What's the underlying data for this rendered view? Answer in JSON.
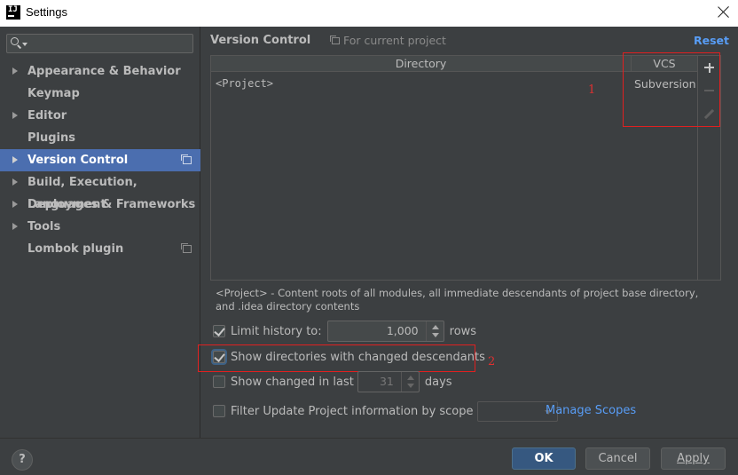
{
  "window": {
    "title": "Settings"
  },
  "sidebar": {
    "search": {
      "placeholder": "",
      "value": ""
    },
    "items": [
      {
        "label": "Appearance & Behavior",
        "expandable": true
      },
      {
        "label": "Keymap",
        "expandable": false
      },
      {
        "label": "Editor",
        "expandable": true
      },
      {
        "label": "Plugins",
        "expandable": false
      },
      {
        "label": "Version Control",
        "expandable": true,
        "selected": true,
        "project_icon": true
      },
      {
        "label": "Build, Execution, Deployment",
        "expandable": true
      },
      {
        "label": "Languages & Frameworks",
        "expandable": true
      },
      {
        "label": "Tools",
        "expandable": true
      },
      {
        "label": "Lombok plugin",
        "expandable": false,
        "project_icon": true
      }
    ]
  },
  "main": {
    "title": "Version Control",
    "for_project": "For current project",
    "reset": "Reset",
    "table": {
      "headers": {
        "directory": "Directory",
        "vcs": "VCS"
      },
      "rows": [
        {
          "directory": "<Project>",
          "vcs": "Subversion"
        }
      ]
    },
    "annotations": {
      "box1": "1",
      "box2": "2"
    },
    "note": "<Project> - Content roots of all modules, all immediate descendants of project base directory, and .idea directory contents",
    "limit_history": {
      "label": "Limit history to:",
      "value": "1,000",
      "suffix": "rows",
      "checked": true
    },
    "show_dirs": {
      "label": "Show directories with changed descendants",
      "checked": true
    },
    "show_changed": {
      "label": "Show changed in last",
      "value": "31",
      "suffix": "days",
      "checked": false
    },
    "filter_update": {
      "label": "Filter Update Project information by scope",
      "checked": false,
      "scope_value": ""
    },
    "manage_scopes": "Manage Scopes"
  },
  "footer": {
    "help": "?",
    "ok": "OK",
    "cancel": "Cancel",
    "apply": "Apply"
  },
  "colors": {
    "background": "#3c3f41",
    "selection": "#4b6eaf",
    "link": "#589df6",
    "annotation": "#e02020",
    "primary_button": "#365880"
  }
}
